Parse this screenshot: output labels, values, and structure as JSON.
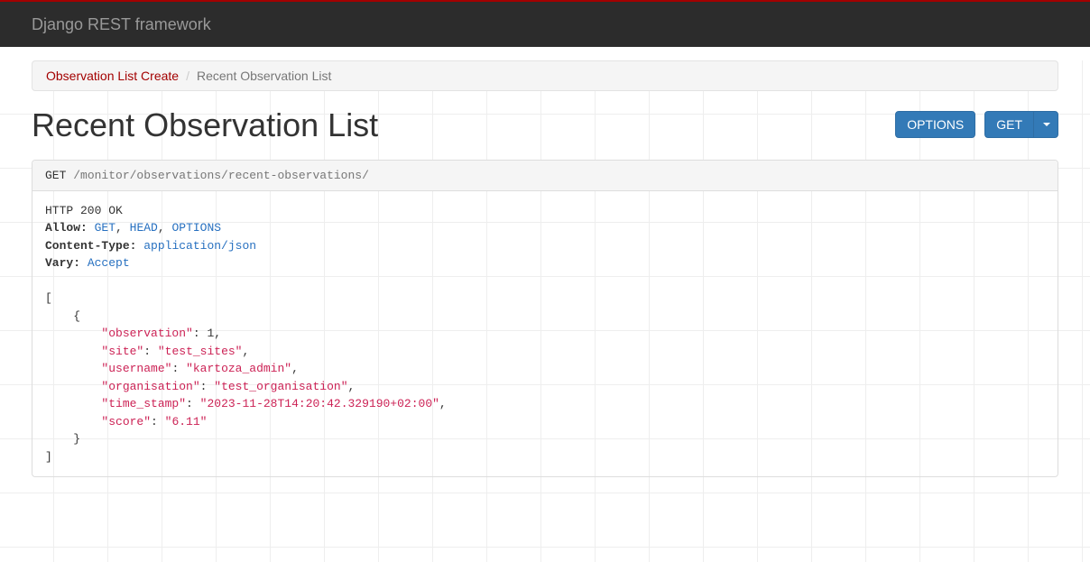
{
  "navbar": {
    "brand": "Django REST framework"
  },
  "breadcrumb": {
    "items": [
      {
        "label": "Observation List Create",
        "active": false
      },
      {
        "label": "Recent Observation List",
        "active": true
      }
    ],
    "divider": "/"
  },
  "page_title": "Recent Observation List",
  "buttons": {
    "options": "OPTIONS",
    "get": "GET"
  },
  "request": {
    "method": "GET",
    "path": "/monitor/observations/recent-observations/"
  },
  "response": {
    "status_line": "HTTP 200 OK",
    "headers": [
      {
        "name": "Allow",
        "values_linked": [
          "GET",
          "HEAD",
          "OPTIONS"
        ]
      },
      {
        "name": "Content-Type",
        "value_linked": "application/json"
      },
      {
        "name": "Vary",
        "value_linked": "Accept"
      }
    ],
    "body": [
      {
        "observation": 1,
        "site": "test_sites",
        "username": "kartoza_admin",
        "organisation": "test_organisation",
        "time_stamp": "2023-11-28T14:20:42.329190+02:00",
        "score": "6.11"
      }
    ]
  }
}
